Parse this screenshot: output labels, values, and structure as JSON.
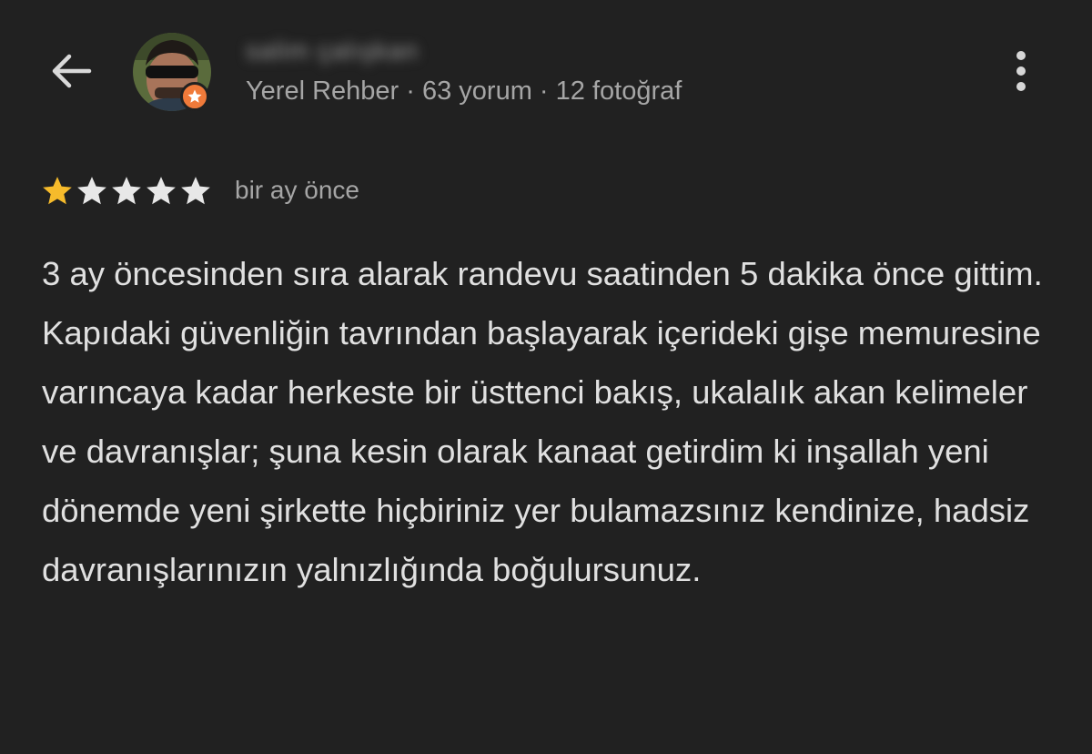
{
  "header": {
    "back_icon": "arrow-left-icon",
    "user": {
      "name": "salim çalışkan",
      "meta": "Yerel Rehber · 63 yorum · 12 fotoğraf",
      "badge_icon": "local-guide-star-icon",
      "badge_color": "#f07a3a"
    },
    "more_icon": "more-vert-icon"
  },
  "review": {
    "rating": 1,
    "max_rating": 5,
    "star_filled_color": "#f6bb2b",
    "star_empty_color": "#e8e8e8",
    "time": "bir ay önce",
    "paragraphs": [
      "3 ay öncesinden sıra alarak randevu saatinden 5 dakika önce gittim.",
      "Kapıdaki güvenliğin tavrından başlayarak içerideki gişe memuresine varıncaya kadar herkeste bir üsttenci bakış, ukalalık akan kelimeler ve davranışlar; şuna kesin olarak kanaat getirdim ki inşallah yeni dönemde yeni şirkette hiçbiriniz yer bulamazsınız kendinize, hadsiz davranışlarınızın yalnızlığında boğulursunuz."
    ]
  }
}
